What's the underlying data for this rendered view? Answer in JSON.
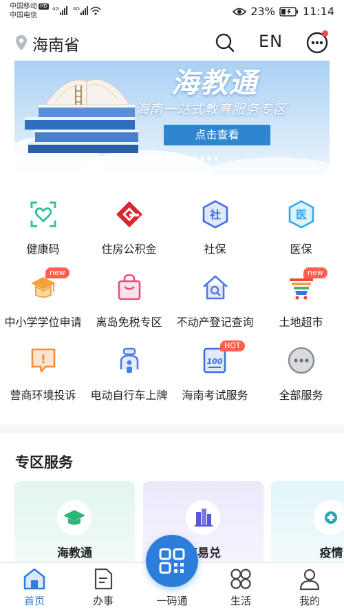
{
  "status_bar": {
    "carrier1": "中国移动",
    "carrier1_badge": "HD",
    "carrier2": "中国电信",
    "net1": "4G",
    "net2": "4G",
    "battery": "23%",
    "time": "11:14"
  },
  "header": {
    "location": "海南省",
    "lang_toggle": "EN",
    "icons": [
      "location-pin-icon",
      "search-icon",
      "more-icon"
    ]
  },
  "banner": {
    "title": "海教通",
    "subtitle": "海南一站式教育服务专区",
    "button": "点击查看",
    "slide_count": 9,
    "active_slide": 1
  },
  "services": [
    {
      "label": "健康码",
      "icon": "health-code-icon",
      "color": "#2fbfa4"
    },
    {
      "label": "住房公积金",
      "icon": "housing-fund-icon",
      "color": "#d9272f"
    },
    {
      "label": "社保",
      "icon": "social-security-icon",
      "color": "#3d6fe0",
      "glyph": "社"
    },
    {
      "label": "医保",
      "icon": "medical-insurance-icon",
      "color": "#35a8e8",
      "glyph": "医"
    },
    {
      "label": "中小学学位申请",
      "icon": "school-enroll-icon",
      "color": "#f1a33a",
      "tag": "new"
    },
    {
      "label": "离岛免税专区",
      "icon": "shopping-bag-icon",
      "color": "#ea4c7a"
    },
    {
      "label": "不动产登记查询",
      "icon": "house-search-icon",
      "color": "#4f79e6"
    },
    {
      "label": "土地超市",
      "icon": "land-market-icon",
      "color": "#e84a3c",
      "tag": "new"
    },
    {
      "label": "营商环境投诉",
      "icon": "complaint-icon",
      "color": "#f08d3a",
      "glyph": "!"
    },
    {
      "label": "电动自行车上牌",
      "icon": "scooter-icon",
      "color": "#4b7de8"
    },
    {
      "label": "海南考试服务",
      "icon": "exam-icon",
      "color": "#3f6ee0",
      "glyph": "100",
      "tag": "HOT"
    },
    {
      "label": "全部服务",
      "icon": "all-services-icon",
      "color": "#8a8f99"
    }
  ],
  "zone": {
    "title": "专区服务",
    "cards": [
      {
        "label": "海教通",
        "icon": "graduation-cap-icon",
        "bg": "#e6f7ef",
        "color": "#2fb57a"
      },
      {
        "label": "琼易兑",
        "icon": "building-icon",
        "bg": "#ecebfb",
        "color": "#5a56d8"
      },
      {
        "label": "疫情",
        "icon": "epidemic-icon",
        "bg": "#e4f5f8",
        "color": "#21a7b5"
      }
    ]
  },
  "nav": {
    "items": [
      {
        "label": "首页",
        "icon": "home-icon",
        "active": true
      },
      {
        "label": "办事",
        "icon": "document-icon",
        "active": false
      },
      {
        "label": "一码通",
        "icon": "qr-code-icon",
        "active": false
      },
      {
        "label": "生活",
        "icon": "life-grid-icon",
        "active": false
      },
      {
        "label": "我的",
        "icon": "user-icon",
        "active": false
      }
    ],
    "accent": "#2f7fd6"
  }
}
